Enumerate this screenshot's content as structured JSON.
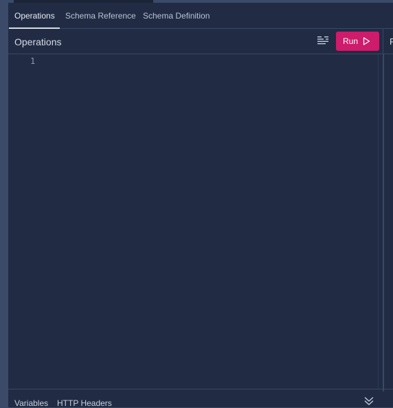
{
  "tabs": [
    {
      "label": "Operations",
      "active": true
    },
    {
      "label": "Schema Reference",
      "active": false
    },
    {
      "label": "Schema Definition",
      "active": false
    }
  ],
  "operations": {
    "title": "Operations",
    "prettify_icon": "prettify-lines-icon",
    "run_label": "Run",
    "run_icon": "play-triangle-icon",
    "run_color": "#cc1c6b"
  },
  "editor": {
    "line_numbers": [
      "1"
    ],
    "content": ""
  },
  "response_pane": {
    "tab_label": "R"
  },
  "bottom": {
    "tabs": [
      {
        "label": "Variables"
      },
      {
        "label": "HTTP Headers"
      }
    ],
    "collapse_icon": "double-chevron-down-icon"
  },
  "colors": {
    "background": "#3b4a69",
    "panel": "#212c44",
    "accent": "#cc1c6b"
  }
}
